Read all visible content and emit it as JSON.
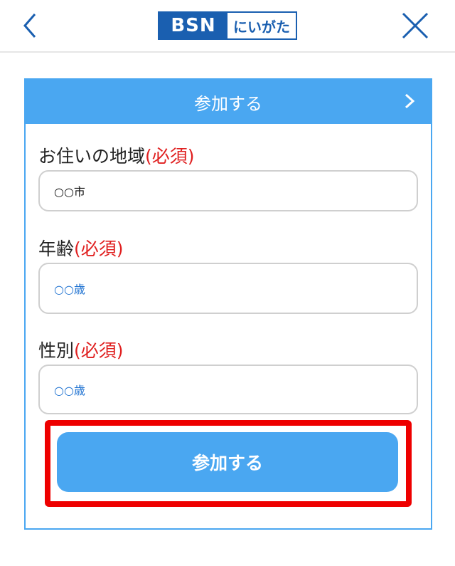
{
  "header": {
    "logo_left": "BSN",
    "logo_right": "にいがた"
  },
  "panel": {
    "title": "参加する"
  },
  "fields": [
    {
      "label": "お住いの地域",
      "required": "(必須)",
      "value": "○○市"
    },
    {
      "label": "年齢",
      "required": "(必須)",
      "value": "○○歳"
    },
    {
      "label": "性別",
      "required": "(必須)",
      "value": "○○歳"
    }
  ],
  "submit_label": "参加する",
  "colors": {
    "accent": "#4aa7f1",
    "logo_blue": "#1a5fb0",
    "required_red": "#e02020",
    "highlight": "#ee0000"
  },
  "icons": {
    "back": "chevron-left-icon",
    "close": "close-icon",
    "panel_arrow": "chevron-right-icon"
  }
}
